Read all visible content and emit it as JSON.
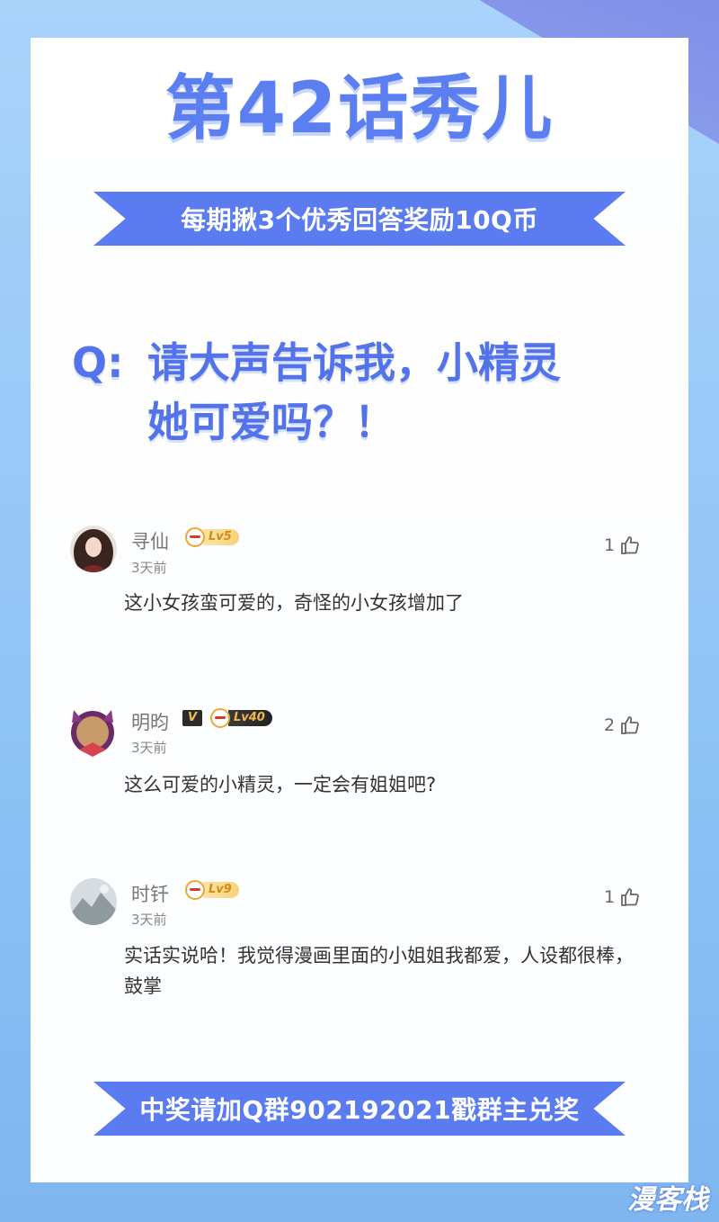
{
  "header": {
    "title": "第42话秀儿",
    "banner": "每期揪3个优秀回答奖励10Q币"
  },
  "question": {
    "prefix": "Q:",
    "line1": "请大声告诉我，小精灵",
    "line2": "她可爱吗？！"
  },
  "comments": [
    {
      "username": "寻仙",
      "level": "Lv5",
      "time": "3天前",
      "likes": "1",
      "text": "这小女孩蛮可爱的，奇怪的小女孩增加了",
      "vip": false
    },
    {
      "username": "明昀",
      "level": "Lv40",
      "time": "3天前",
      "likes": "2",
      "text": "这么可爱的小精灵，一定会有姐姐吧?",
      "vip": true,
      "vip_label": "V"
    },
    {
      "username": "时钎",
      "level": "Lv9",
      "time": "3天前",
      "likes": "1",
      "text": "实话实说哈！我觉得漫画里面的小姐姐我都爱，人设都很棒，鼓掌",
      "vip": false
    }
  ],
  "footer": {
    "banner": "中奖请加Q群902192021戳群主兑奖",
    "watermark": "漫客栈"
  },
  "colors": {
    "accent": "#5a7cf0",
    "question": "#5473ea",
    "background": "#a9d3fb"
  }
}
